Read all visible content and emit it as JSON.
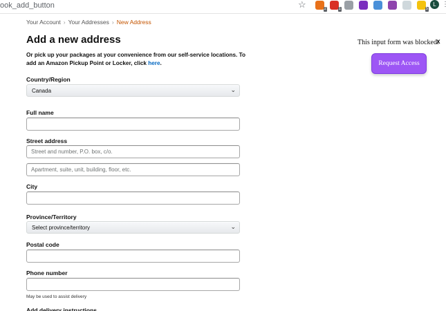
{
  "browser": {
    "url_fragment": "ook_add_button",
    "star_glyph": "☆",
    "extensions": [
      {
        "name": "ext-orange",
        "color": "#e8711a",
        "badge": "2"
      },
      {
        "name": "ext-red",
        "color": "#d93025",
        "badge": "1"
      },
      {
        "name": "ext-gray",
        "color": "#9aa0a6",
        "badge": ""
      },
      {
        "name": "ext-purple",
        "color": "#7b2fbe",
        "badge": ""
      },
      {
        "name": "ext-blue",
        "color": "#4a90d9",
        "badge": ""
      },
      {
        "name": "ext-violet",
        "color": "#8e44ad",
        "badge": ""
      },
      {
        "name": "ext-pinwheel",
        "color": "#cfd8dc",
        "badge": ""
      },
      {
        "name": "ext-yellow",
        "color": "#f4c20d",
        "badge": "5"
      }
    ],
    "profile_initial": "L",
    "menu_glyph": "⋮"
  },
  "breadcrumb": {
    "items": [
      "Your Account",
      "Your Addresses"
    ],
    "current": "New Address",
    "separator": "›"
  },
  "page_title": "Add a new address",
  "pickup": {
    "text": "Or pick up your packages at your convenience from our self-service locations. To add an Amazon Pickup Point or Locker, click ",
    "link": "here",
    "suffix": "."
  },
  "form": {
    "country_label": "Country/Region",
    "country_value": "Canada",
    "full_name_label": "Full name",
    "full_name_value": "",
    "street_label": "Street address",
    "street_placeholder_1": "Street and number, P.O. box, c/o.",
    "street_placeholder_2": "Apartment, suite, unit, building, floor, etc.",
    "city_label": "City",
    "province_label": "Province/Territory",
    "province_value": "Select province/territory",
    "postal_label": "Postal code",
    "phone_label": "Phone number",
    "phone_hint": "May be used to assist delivery",
    "next_section_cut": "Add delivery instructions"
  },
  "blocker": {
    "message": "This input form was blocked.",
    "close_label": "x",
    "button_label": "Request Access",
    "button_color": "#9d56f5"
  },
  "colors": {
    "link": "#0066c0",
    "breadcrumb_current": "#c45500"
  }
}
